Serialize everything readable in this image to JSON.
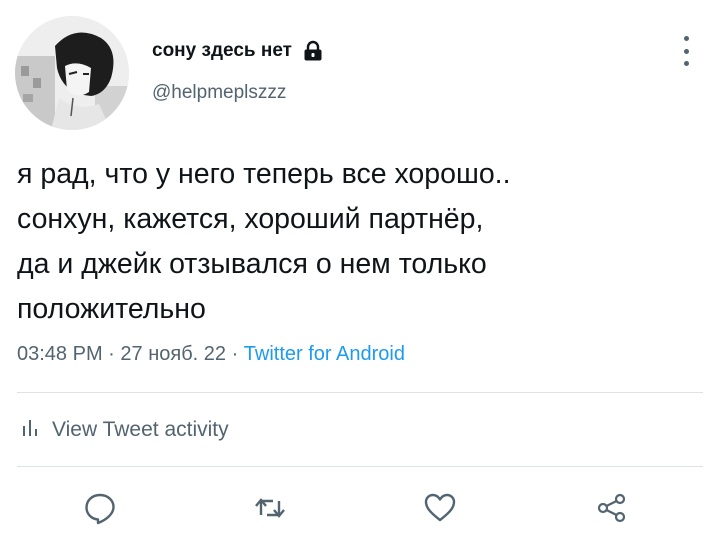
{
  "user": {
    "display_name": "сону здесь нет",
    "handle": "@helpmeplszzz"
  },
  "tweet": {
    "lines": [
      "я рад, что у него теперь все хорошо..",
      "сонхун, кажется, хороший партнёр,",
      "да и джейк отзывался о нем только",
      "положительно"
    ]
  },
  "meta": {
    "time": "03:48 PM",
    "separator": " · ",
    "date": "27 нояб. 22",
    "source": "Twitter for Android"
  },
  "activity": {
    "label": "View Tweet activity"
  },
  "icons": {
    "lock": "lock-icon",
    "more": "more-icon",
    "reply": "reply-icon",
    "retweet": "retweet-icon",
    "like": "heart-icon",
    "share": "share-icon",
    "activity": "bar-chart-icon"
  },
  "colors": {
    "text": "#0f1419",
    "secondary": "#536471",
    "link": "#1d9bf0",
    "divider": "#dfe3e6"
  }
}
